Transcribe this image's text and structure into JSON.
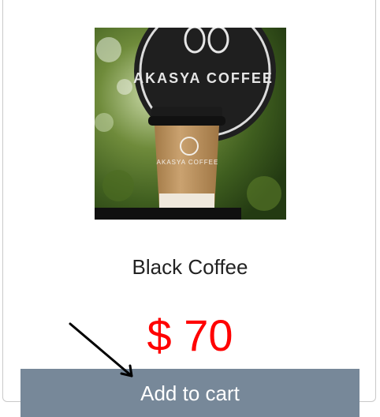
{
  "product": {
    "image_icon": "coffee-cup-photo",
    "cup_logo_text": "AKASYA COFFEE",
    "sign_text": "AKASYA COFFEE",
    "name": "Black Coffee",
    "price": "$ 70"
  },
  "actions": {
    "add_to_cart_label": "Add to cart"
  },
  "colors": {
    "price": "#ff0000",
    "button_bg": "#778899",
    "button_text": "#ffffff"
  }
}
